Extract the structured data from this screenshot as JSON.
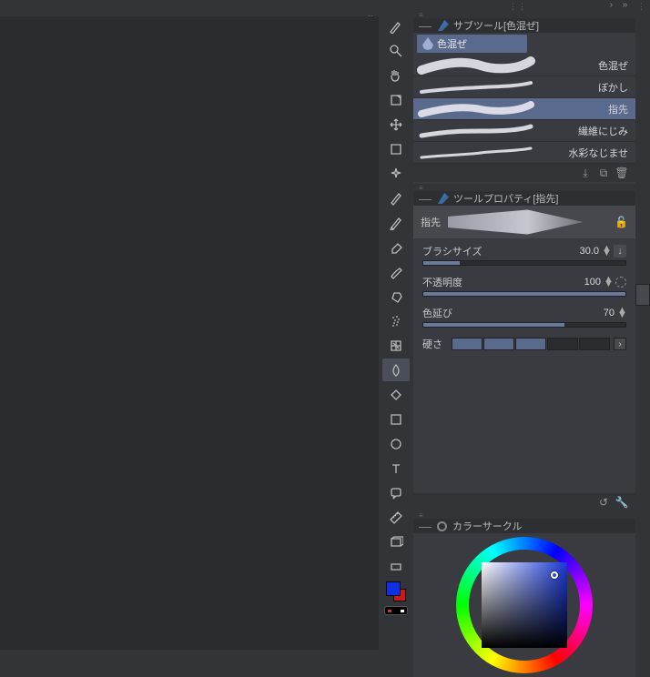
{
  "panels": {
    "subtool": {
      "title": "サブツール[色混ぜ]",
      "tab_label": "色混ぜ"
    },
    "toolprop": {
      "title": "ツールプロパティ[指先]",
      "current_tool": "指先"
    },
    "colorcircle": {
      "title": "カラーサークル"
    }
  },
  "subtools": [
    {
      "label": "色混ぜ",
      "selected": false,
      "thick": 10
    },
    {
      "label": "ぼかし",
      "selected": false,
      "thick": 4
    },
    {
      "label": "指先",
      "selected": true,
      "thick": 8
    },
    {
      "label": "繊維にじみ",
      "selected": false,
      "thick": 5
    },
    {
      "label": "水彩なじませ",
      "selected": false,
      "thick": 3
    }
  ],
  "properties": {
    "brush_size": {
      "label": "ブラシサイズ",
      "value": "30.0",
      "fill": 18
    },
    "opacity": {
      "label": "不透明度",
      "value": "100",
      "fill": 100
    },
    "color_stretch": {
      "label": "色延び",
      "value": "70",
      "fill": 70
    },
    "hardness": {
      "label": "硬さ",
      "level": 3,
      "max": 5
    }
  },
  "colors": {
    "foreground": "#1030e8",
    "background": "#d01818",
    "accent": "#5a6a8c"
  },
  "tools": [
    "brush",
    "zoom",
    "hand",
    "rotate",
    "move",
    "marquee",
    "wand",
    "pen",
    "pencil",
    "eraser",
    "brush2",
    "airbrush",
    "spray",
    "pattern",
    "blend",
    "fill",
    "shape",
    "ellipse",
    "text",
    "balloon",
    "ruler",
    "frame",
    "gradient"
  ],
  "selected_tool_index": 14
}
